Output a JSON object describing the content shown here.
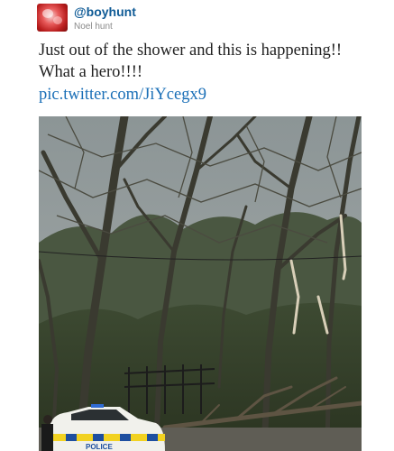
{
  "tweet": {
    "handle": "@boyhunt",
    "display_name": "Noel hunt",
    "text": "Just out of the shower and this is happening!! What a hero!!!!",
    "link": "pic.twitter.com/JiYcegx9"
  },
  "photo": {
    "police_car_label": "POLICE"
  },
  "colors": {
    "handle": "#0f5b96",
    "link": "#1a6fb7",
    "text": "#222222"
  }
}
